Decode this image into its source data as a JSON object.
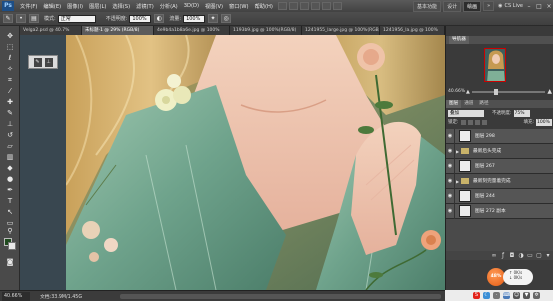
{
  "app": {
    "logo": "Ps",
    "title": "Photoshop CS5"
  },
  "menu": [
    "文件(F)",
    "编辑(E)",
    "图像(I)",
    "图层(L)",
    "选择(S)",
    "滤镜(T)",
    "分析(A)",
    "3D(D)",
    "视图(V)",
    "窗口(W)",
    "帮助(H)"
  ],
  "workspace": {
    "items": [
      "基本功能",
      "设计",
      "绘画"
    ],
    "active": "绘画",
    "more": "»",
    "cslive": "CS Live"
  },
  "options_bar": {
    "mode_label": "模式:",
    "mode_value": "正常",
    "opacity_label": "不透明度:",
    "opacity_value": "100%",
    "flow_label": "流量:",
    "flow_value": "100%"
  },
  "doc_tabs": [
    {
      "label": "Velga2.psd @ 40.7%",
      "active": false
    },
    {
      "label": "未标题-1 @ 29% (RGB/8)",
      "active": true
    },
    {
      "label": "4e9b4a1b8a6e.jpg @ 100%",
      "active": false
    },
    {
      "label": "1193b9.jpg @ 100%(RGB/8)",
      "active": false
    },
    {
      "label": "1241955_large.jpg @ 100%(RGB/8)",
      "active": false
    },
    {
      "label": "1241956_la.jpg @ 100%",
      "active": false
    }
  ],
  "status": {
    "zoom": "40.66%",
    "doc": "文档:33.9M/1.45G"
  },
  "navigator": {
    "tab": "导航器",
    "zoom": "40.66%"
  },
  "layers_panel": {
    "tabs": [
      "图层",
      "通道",
      "路径"
    ],
    "active_tab": "图层",
    "blend_mode": "叠加",
    "opacity_label": "不透明度:",
    "opacity_value": "75%",
    "lock_label": "锁定:",
    "fill_label": "填充:",
    "fill_value": "100%",
    "layers": [
      {
        "name": "图层 298",
        "type": "layer",
        "selected": false
      },
      {
        "name": "最新后头完成",
        "type": "group",
        "selected": false
      },
      {
        "name": "图层 267",
        "type": "layer",
        "selected": false
      },
      {
        "name": "最新刻完量着完成",
        "type": "group",
        "selected": false
      },
      {
        "name": "图层 244",
        "type": "layer",
        "selected": false
      },
      {
        "name": "图层 272 副本",
        "type": "layer",
        "selected": false
      }
    ],
    "footer_icons": [
      "link-icon",
      "fx-icon",
      "mask-icon",
      "adjustment-icon",
      "folder-icon",
      "new-layer-icon",
      "trash-icon"
    ]
  },
  "widget": {
    "percent": "48%",
    "up": "0K/s",
    "down": "0K/s"
  },
  "colors": {
    "foreground": "#1f4a1e",
    "background": "#e9e9e9",
    "canvas_green": "#7f9268"
  }
}
